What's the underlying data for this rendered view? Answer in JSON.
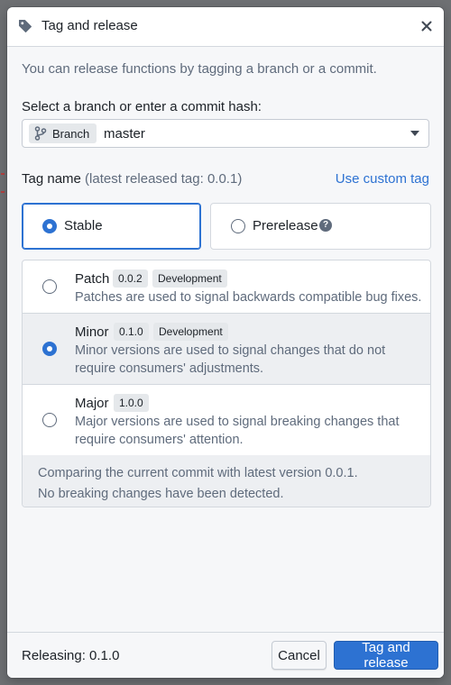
{
  "dialog": {
    "title": "Tag and release",
    "intro": "You can release functions by tagging a branch or a commit."
  },
  "branch_field": {
    "label": "Select a branch or enter a commit hash:",
    "tag_label": "Branch",
    "value": "master"
  },
  "tag_name": {
    "label": "Tag name",
    "hint": "(latest released tag: 0.0.1)",
    "custom_link": "Use custom tag"
  },
  "release_type": {
    "stable_label": "Stable",
    "prerelease_label": "Prerelease",
    "selected": "Stable"
  },
  "versions": [
    {
      "name": "Patch",
      "version": "0.0.2",
      "badge": "Development",
      "description": "Patches are used to signal backwards compatible bug fixes.",
      "selected": false
    },
    {
      "name": "Minor",
      "version": "0.1.0",
      "badge": "Development",
      "description": "Minor versions are used to signal changes that do not require consumers' adjustments.",
      "selected": true
    },
    {
      "name": "Major",
      "version": "1.0.0",
      "badge": "",
      "description": "Major versions are used to signal breaking changes that require consumers' attention.",
      "selected": false
    }
  ],
  "comparison": {
    "line1": "Comparing the current commit with latest version 0.0.1.",
    "line2": "No breaking changes have been detected."
  },
  "footer": {
    "releasing": "Releasing: 0.1.0",
    "cancel_label": "Cancel",
    "submit_label": "Tag and release"
  },
  "icons": {
    "title_icon": "tag-icon",
    "close_icon": "close-icon",
    "branch_icon": "git-branch-icon",
    "help_icon": "help-icon"
  },
  "colors": {
    "accent": "#2d72d2",
    "muted_text": "#5f6b7c"
  }
}
